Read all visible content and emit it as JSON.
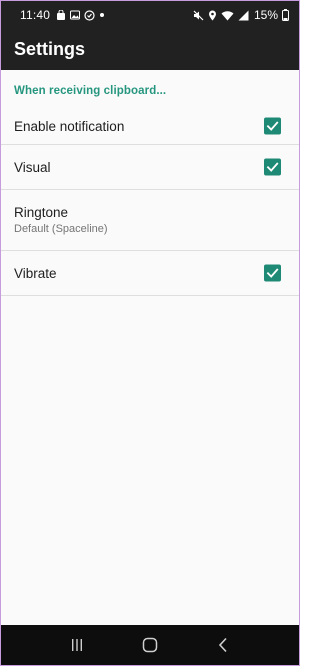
{
  "status_bar": {
    "time": "11:40",
    "battery_percent": "15%",
    "left_icons": [
      "bag-icon",
      "image-icon",
      "sync-icon",
      "dot-icon"
    ],
    "right_icons": [
      "mute-icon",
      "location-icon",
      "wifi-icon",
      "signal-icon",
      "battery-icon"
    ]
  },
  "app_bar": {
    "title": "Settings"
  },
  "settings": {
    "category_title": "When receiving clipboard...",
    "items": [
      {
        "title": "Enable notification",
        "checked": true
      },
      {
        "title": "Visual",
        "checked": true
      },
      {
        "title": "Ringtone",
        "summary": "Default (Spaceline)"
      },
      {
        "title": "Vibrate",
        "checked": true
      }
    ]
  },
  "nav_bar": {
    "buttons": [
      "recents-icon",
      "home-icon",
      "back-icon"
    ]
  },
  "colors": {
    "accent": "#26967f",
    "checkbox": "#1e8a76",
    "app_bar": "#212121",
    "nav_bar": "#0d0d0d",
    "background": "#fafafa"
  }
}
